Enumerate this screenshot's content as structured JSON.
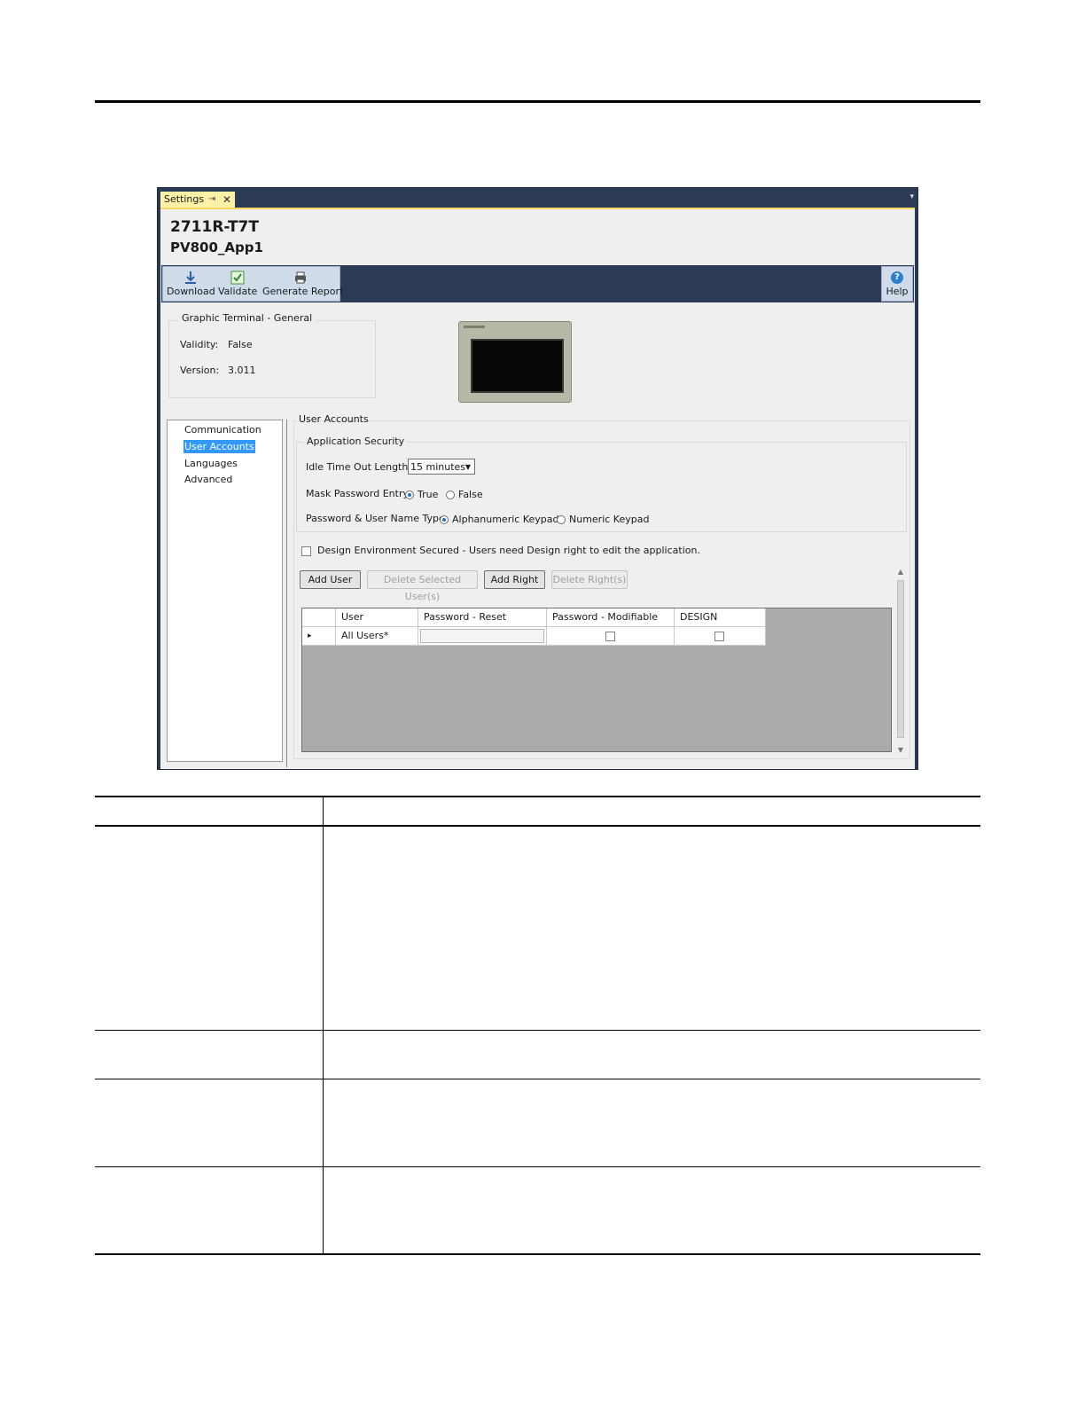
{
  "window": {
    "tab_title": "Settings",
    "tab_pin_glyph": "⇥",
    "tab_close_glyph": "✕",
    "tab_dropdown_glyph": "▾",
    "model": "2711R-T7T",
    "app_name": "PV800_App1"
  },
  "toolbar": {
    "download": "Download",
    "validate": "Validate",
    "generate_report": "Generate Report",
    "help": "Help",
    "help_glyph": "?"
  },
  "general": {
    "title": "Graphic Terminal - General",
    "validity_label": "Validity:",
    "validity_value": "False",
    "version_label": "Version:",
    "version_value": "3.011"
  },
  "nav": {
    "items": [
      "Communication",
      "User Accounts",
      "Languages",
      "Advanced"
    ],
    "selected": "User Accounts"
  },
  "user_accounts": {
    "title": "User Accounts",
    "security_title": "Application Security",
    "idle_label": "Idle Time Out Length :",
    "idle_value": "15 minutes",
    "mask_label": "Mask Password Entry:",
    "mask_true": "True",
    "mask_false": "False",
    "mask_selected": "True",
    "type_label": "Password & User Name Type:",
    "type_alpha": "Alphanumeric Keypad",
    "type_numeric": "Numeric Keypad",
    "type_selected": "Alphanumeric Keypad",
    "design_secured_label": "Design Environment Secured - Users need Design right to edit the application.",
    "design_secured_checked": false
  },
  "buttons": {
    "add_user": "Add User",
    "delete_users": "Delete Selected User(s)",
    "add_right": "Add Right",
    "delete_rights": "Delete Right(s)"
  },
  "grid": {
    "columns": [
      "User",
      "Password - Reset",
      "Password - Modifiable",
      "DESIGN"
    ],
    "rows": [
      {
        "user": "All Users*",
        "password_reset": "",
        "password_modifiable": false,
        "design": false
      }
    ],
    "row_indicator_glyph": "▸"
  },
  "scrollbar": {
    "up_glyph": "▲",
    "down_glyph": "▼"
  },
  "colors": {
    "window_frame": "#2b3a55",
    "tab_active": "#fff1a6",
    "selection": "#3399ff",
    "grid_background": "#ababab"
  }
}
